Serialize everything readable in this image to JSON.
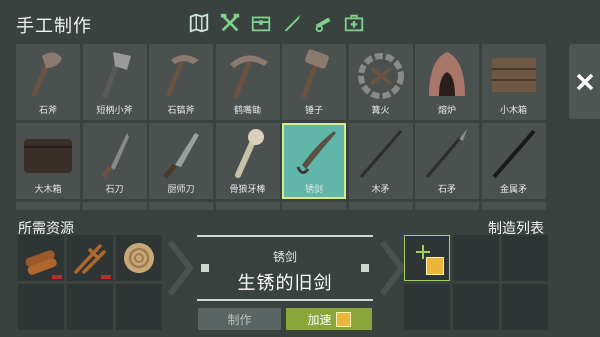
{
  "header": {
    "title": "手工制作",
    "tabs": [
      {
        "icon": "map-icon"
      },
      {
        "icon": "crossed-tools-icon"
      },
      {
        "icon": "chest-icon"
      },
      {
        "icon": "blade-icon"
      },
      {
        "icon": "cannon-icon"
      },
      {
        "icon": "medkit-icon"
      }
    ]
  },
  "items": [
    {
      "label": "石斧",
      "icon": "stone-axe-icon"
    },
    {
      "label": "短柄小斧",
      "icon": "hatchet-icon"
    },
    {
      "label": "石镐斧",
      "icon": "stone-pickaxe-axe-icon"
    },
    {
      "label": "鹤嘴锄",
      "icon": "pickaxe-icon"
    },
    {
      "label": "锤子",
      "icon": "hammer-icon"
    },
    {
      "label": "篝火",
      "icon": "campfire-icon"
    },
    {
      "label": "熔炉",
      "icon": "furnace-icon"
    },
    {
      "label": "小木箱",
      "icon": "small-crate-icon"
    },
    {
      "label": "大木箱",
      "icon": "large-chest-icon"
    },
    {
      "label": "石刀",
      "icon": "stone-knife-icon"
    },
    {
      "label": "厨师刀",
      "icon": "chef-knife-icon"
    },
    {
      "label": "骨狼牙棒",
      "icon": "bone-club-icon"
    },
    {
      "label": "锈剑",
      "icon": "rusty-sword-icon",
      "selected": true
    },
    {
      "label": "木矛",
      "icon": "wooden-spear-icon"
    },
    {
      "label": "石矛",
      "icon": "stone-spear-icon"
    },
    {
      "label": "金属矛",
      "icon": "metal-spear-icon"
    }
  ],
  "requirements": {
    "title": "所需资源",
    "slots": [
      {
        "icon": "logs-icon"
      },
      {
        "icon": "branches-icon"
      },
      {
        "icon": "rope-icon"
      },
      {
        "icon": ""
      },
      {
        "icon": ""
      },
      {
        "icon": ""
      }
    ]
  },
  "selected": {
    "name": "锈剑",
    "description": "生锈的旧剑"
  },
  "buttons": {
    "craft": "制作",
    "speedup": "加速"
  },
  "queue": {
    "title": "制造列表"
  },
  "colors": {
    "background": "#3a4240",
    "cell": "#4a514f",
    "selected_cell": "#5fb6a9",
    "speed_button": "#8aa53a",
    "accent_green": "#9ecf5a"
  }
}
